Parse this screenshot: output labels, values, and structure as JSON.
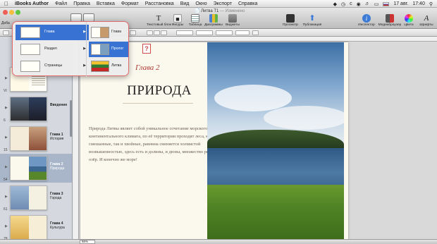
{
  "menubar": {
    "app_name": "iBooks Author",
    "items": [
      "Файл",
      "Правка",
      "Вставка",
      "Формат",
      "Расстановка",
      "Вид",
      "Окно",
      "Экспорт",
      "Справка"
    ],
    "date": "17 авг.",
    "time": "17:40"
  },
  "window": {
    "title": "Литва Т1",
    "title_suffix": "— Изменено"
  },
  "toolbar": {
    "add_label": "Доба",
    "items": [
      "Текстовый блок",
      "Фигуры",
      "Таблица",
      "Диаграммы",
      "Виджеты",
      "Просмотр",
      "Публикация",
      "Инспектор",
      "Медиабраузер",
      "Цвета",
      "Шрифты"
    ]
  },
  "popup": {
    "menu_items": [
      "Глава",
      "Раздел",
      "Страницы"
    ],
    "submenu_items": [
      "Глава",
      "Пролог",
      "Литва"
    ],
    "callout": "?"
  },
  "sidebar": {
    "rows": [
      {
        "page": "VI",
        "label_title": "",
        "label_sub": ""
      },
      {
        "page": "6",
        "label_title": "Введение",
        "label_sub": ""
      },
      {
        "page": "15",
        "label_title": "Глава 1",
        "label_sub": "История"
      },
      {
        "page": "54",
        "label_title": "Глава 2",
        "label_sub": "Природа"
      },
      {
        "page": "61",
        "label_title": "Глава 3",
        "label_sub": "Города"
      },
      {
        "page": "78",
        "label_title": "Глава 4",
        "label_sub": "Культура"
      }
    ]
  },
  "canvas": {
    "chapter_label": "Глава 2",
    "chapter_title": "ПРИРОДА",
    "body": "Природа Литвы являет собой уникальное сочетание морского и континентального климата, по её территории проходят леса, как смешанные, так и хвойные, равнина сменяется холмистой возвышенностью, здесь есть и долины, и дюны, множество рек и озёр. И конечно же море!"
  },
  "bottombar": {
    "zoom": "86%"
  }
}
